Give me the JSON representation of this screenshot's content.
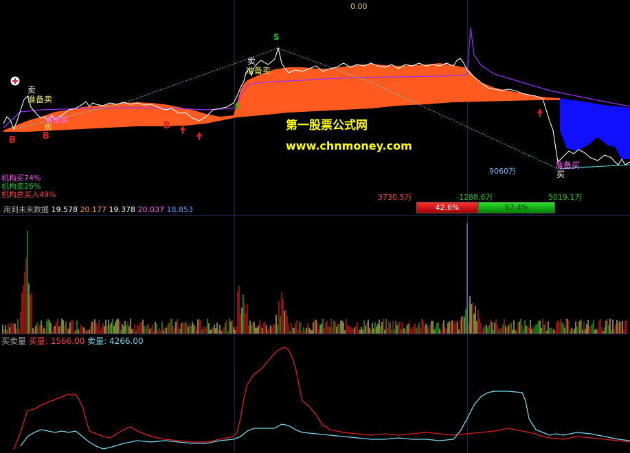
{
  "top_value": "0.00",
  "watermark": {
    "title": "第一股票公式网",
    "url": "www.chnmoney.com"
  },
  "signals": {
    "sell": "卖",
    "prepare_sell": "准备卖",
    "prepare_buy": "准备买",
    "buy": "买",
    "b": "B",
    "s": "S"
  },
  "legend": {
    "inst_buy": "机构买74%",
    "inst_sell": "机构卖26%",
    "inst_total": "机构总买入49%"
  },
  "indicator_line": {
    "label": "用到未来数据",
    "v1": "19.578",
    "v2": "20.177",
    "v3": "19.378",
    "v4": "20.037",
    "v5": "18.853"
  },
  "flow": {
    "left": "3730.5万",
    "mid": "-1288.6万",
    "right": "5019.1万",
    "amount": "9060万",
    "buy_pct": "42.6%",
    "sell_pct": "57.4%"
  },
  "bottom_panel": {
    "title": "买卖量",
    "buy_label": "买量:",
    "buy_value": "1566.00",
    "sell_label": "卖量:",
    "sell_value": "4266.00"
  },
  "colors": {
    "price": "#ffffff",
    "fill_orange": "#ff5a1f",
    "fill_blue": "#1010ff",
    "ma_purple": "#9a30ff",
    "cyan": "#4fd8d8",
    "buy_red": "#e02020",
    "sell_green": "#18c818"
  }
}
